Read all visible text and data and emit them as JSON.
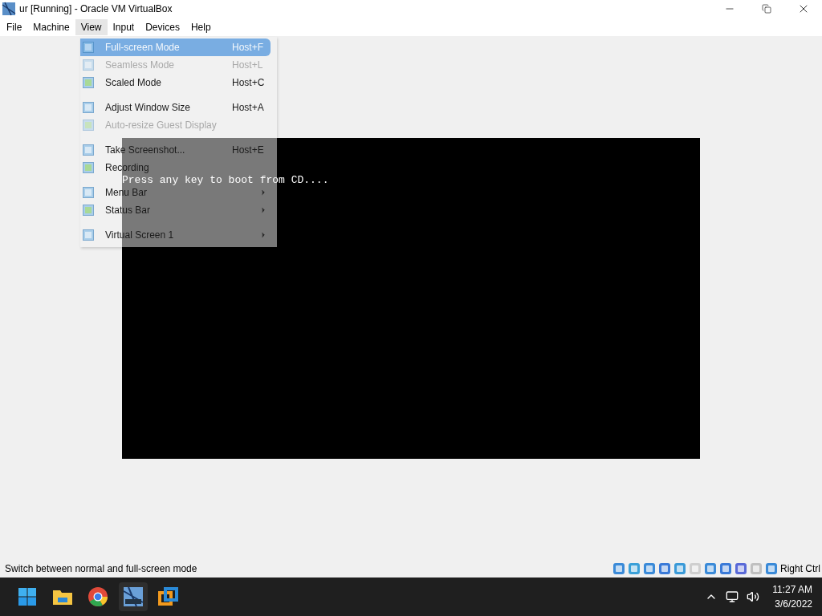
{
  "window": {
    "title": "ur [Running] - Oracle VM VirtualBox"
  },
  "menubar": [
    {
      "label": "File",
      "selected": false
    },
    {
      "label": "Machine",
      "selected": false
    },
    {
      "label": "View",
      "selected": true
    },
    {
      "label": "Input",
      "selected": false
    },
    {
      "label": "Devices",
      "selected": false
    },
    {
      "label": "Help",
      "selected": false
    }
  ],
  "view_menu": [
    {
      "kind": "item",
      "label": "Full-screen Mode",
      "shortcut": "Host+F",
      "selected": true,
      "disabled": false,
      "submenu": false
    },
    {
      "kind": "item",
      "label": "Seamless Mode",
      "shortcut": "Host+L",
      "selected": false,
      "disabled": true,
      "submenu": false
    },
    {
      "kind": "item",
      "label": "Scaled Mode",
      "shortcut": "Host+C",
      "selected": false,
      "disabled": false,
      "submenu": false
    },
    {
      "kind": "separator"
    },
    {
      "kind": "item",
      "label": "Adjust Window Size",
      "shortcut": "Host+A",
      "selected": false,
      "disabled": false,
      "submenu": false
    },
    {
      "kind": "item",
      "label": "Auto-resize Guest Display",
      "selected": false,
      "disabled": true,
      "submenu": false
    },
    {
      "kind": "separator"
    },
    {
      "kind": "item",
      "label": "Take Screenshot...",
      "shortcut": "Host+E",
      "selected": false,
      "disabled": false,
      "submenu": false
    },
    {
      "kind": "item",
      "label": "Recording",
      "selected": false,
      "disabled": false,
      "submenu": false
    },
    {
      "kind": "separator"
    },
    {
      "kind": "item",
      "label": "Menu Bar",
      "selected": false,
      "disabled": false,
      "submenu": true
    },
    {
      "kind": "item",
      "label": "Status Bar",
      "selected": false,
      "disabled": false,
      "submenu": true
    },
    {
      "kind": "separator"
    },
    {
      "kind": "item",
      "label": "Virtual Screen 1",
      "selected": false,
      "disabled": false,
      "submenu": true
    }
  ],
  "guest_screen": {
    "text": "Press any key to boot from CD...."
  },
  "status_bar": {
    "message": "Switch between normal and full-screen mode",
    "host_key": "Right Ctrl"
  },
  "taskbar": {
    "time": "11:27 AM",
    "date": "3/6/2022"
  }
}
